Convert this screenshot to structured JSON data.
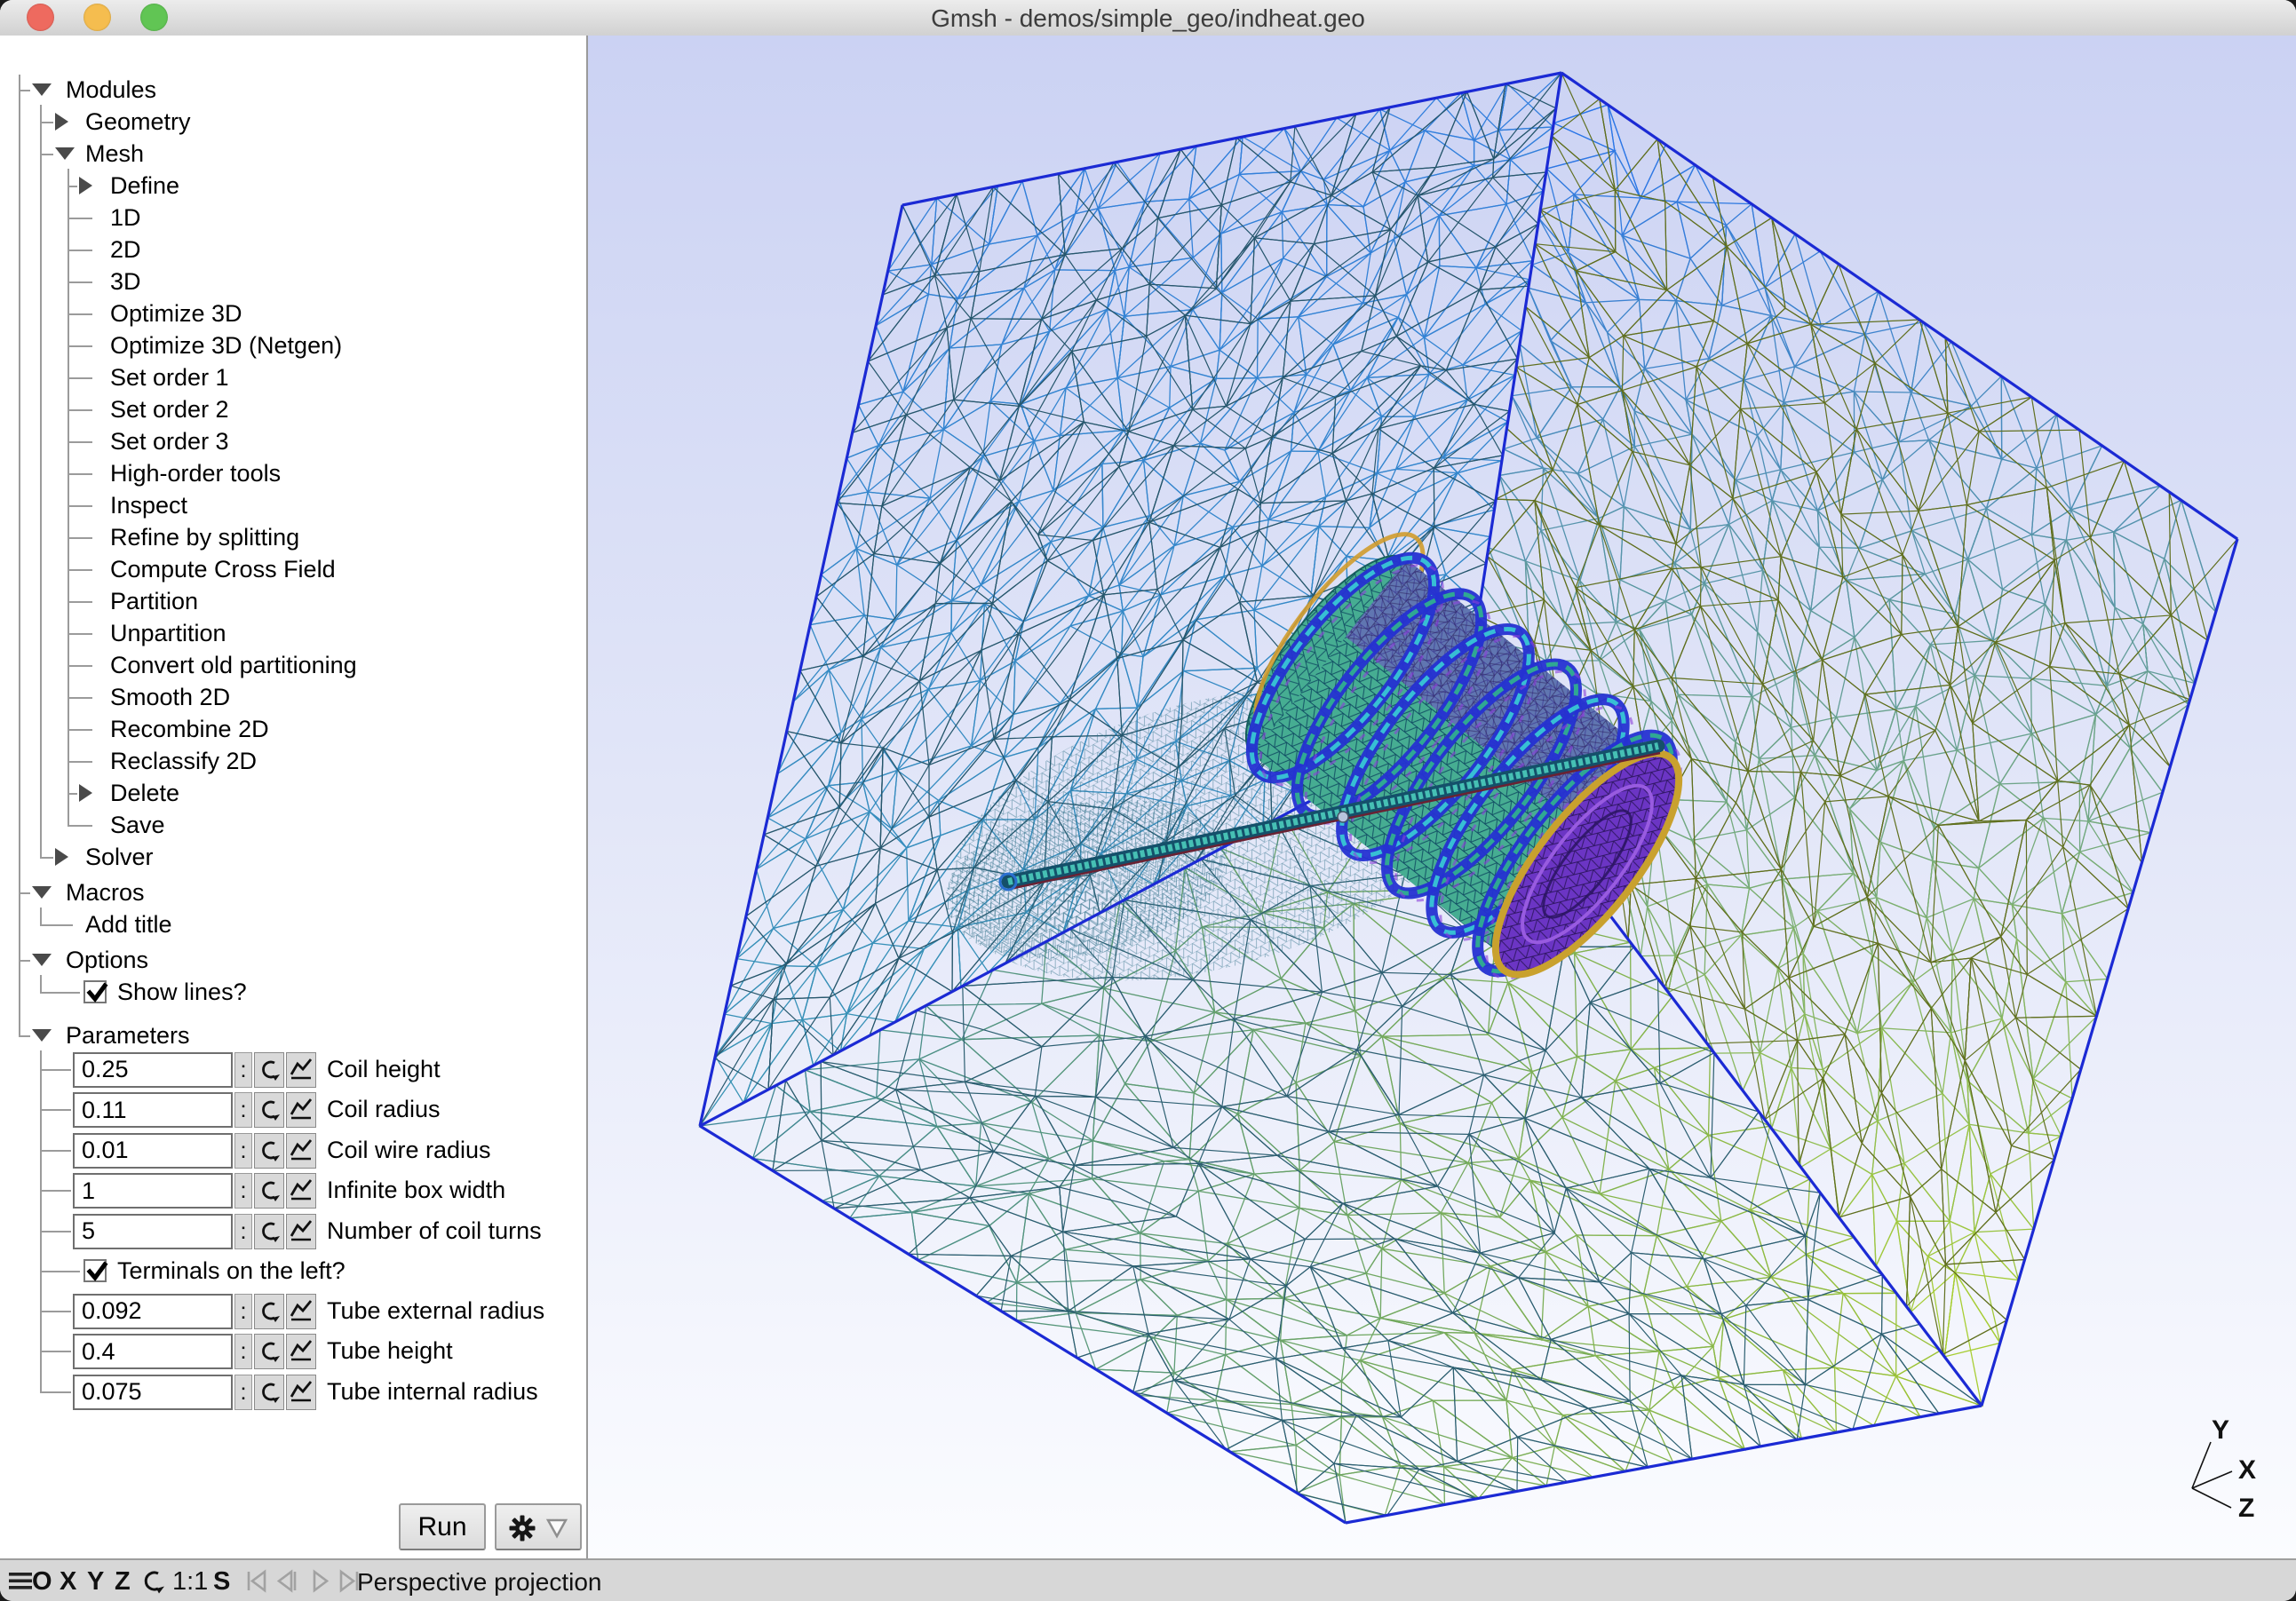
{
  "window": {
    "title": "Gmsh - demos/simple_geo/indheat.geo",
    "traffic_lights": [
      {
        "name": "close-button",
        "color": "#ee6a5f"
      },
      {
        "name": "minimize-button",
        "color": "#f5bd4f"
      },
      {
        "name": "zoom-button",
        "color": "#61c554"
      }
    ]
  },
  "tree": {
    "items": [
      {
        "type": "branch",
        "depth": 0,
        "state": "expanded",
        "label": "Modules"
      },
      {
        "type": "branch",
        "depth": 1,
        "state": "collapsed",
        "label": "Geometry"
      },
      {
        "type": "branch",
        "depth": 1,
        "state": "expanded",
        "label": "Mesh"
      },
      {
        "type": "branch",
        "depth": 2,
        "state": "collapsed",
        "label": "Define"
      },
      {
        "type": "leaf",
        "depth": 2,
        "label": "1D"
      },
      {
        "type": "leaf",
        "depth": 2,
        "label": "2D"
      },
      {
        "type": "leaf",
        "depth": 2,
        "label": "3D"
      },
      {
        "type": "leaf",
        "depth": 2,
        "label": "Optimize 3D"
      },
      {
        "type": "leaf",
        "depth": 2,
        "label": "Optimize 3D (Netgen)"
      },
      {
        "type": "leaf",
        "depth": 2,
        "label": "Set order 1"
      },
      {
        "type": "leaf",
        "depth": 2,
        "label": "Set order 2"
      },
      {
        "type": "leaf",
        "depth": 2,
        "label": "Set order 3"
      },
      {
        "type": "leaf",
        "depth": 2,
        "label": "High-order tools"
      },
      {
        "type": "leaf",
        "depth": 2,
        "label": "Inspect"
      },
      {
        "type": "leaf",
        "depth": 2,
        "label": "Refine by splitting"
      },
      {
        "type": "leaf",
        "depth": 2,
        "label": "Compute Cross Field"
      },
      {
        "type": "leaf",
        "depth": 2,
        "label": "Partition"
      },
      {
        "type": "leaf",
        "depth": 2,
        "label": "Unpartition"
      },
      {
        "type": "leaf",
        "depth": 2,
        "label": "Convert old partitioning"
      },
      {
        "type": "leaf",
        "depth": 2,
        "label": "Smooth 2D"
      },
      {
        "type": "leaf",
        "depth": 2,
        "label": "Recombine 2D"
      },
      {
        "type": "leaf",
        "depth": 2,
        "label": "Reclassify 2D"
      },
      {
        "type": "branch",
        "depth": 2,
        "state": "collapsed",
        "label": "Delete"
      },
      {
        "type": "leaf",
        "depth": 2,
        "label": "Save"
      },
      {
        "type": "branch",
        "depth": 1,
        "state": "collapsed",
        "label": "Solver"
      },
      {
        "type": "branch",
        "depth": 0,
        "state": "expanded",
        "label": "Macros"
      },
      {
        "type": "leaf",
        "depth": 1,
        "label": "Add title"
      },
      {
        "type": "branch",
        "depth": 0,
        "state": "expanded",
        "label": "Options"
      },
      {
        "type": "checkbox",
        "depth": 1,
        "checked": true,
        "label": "Show lines?"
      },
      {
        "type": "branch",
        "depth": 0,
        "state": "expanded",
        "label": "Parameters"
      },
      {
        "type": "param",
        "depth": 1,
        "value": "0.25",
        "label": "Coil height"
      },
      {
        "type": "param",
        "depth": 1,
        "value": "0.11",
        "label": "Coil radius"
      },
      {
        "type": "param",
        "depth": 1,
        "value": "0.01",
        "label": "Coil wire radius"
      },
      {
        "type": "param",
        "depth": 1,
        "value": "1",
        "label": "Infinite box width"
      },
      {
        "type": "param",
        "depth": 1,
        "value": "5",
        "label": "Number of coil turns"
      },
      {
        "type": "checkbox",
        "depth": 1,
        "checked": true,
        "label": "Terminals on the left?"
      },
      {
        "type": "param",
        "depth": 1,
        "value": "0.092",
        "label": "Tube external radius"
      },
      {
        "type": "param",
        "depth": 1,
        "value": "0.4",
        "label": "Tube height"
      },
      {
        "type": "param",
        "depth": 1,
        "value": "0.075",
        "label": "Tube internal radius"
      }
    ],
    "param_controls": {
      "colon": ":",
      "update_icon": "refresh-icon",
      "plot_icon": "chart-icon"
    }
  },
  "actions": {
    "run_label": "Run",
    "gear_icon": "gear-icon",
    "dropdown_icon": "triangle-down-icon"
  },
  "status_bar": {
    "menu_icon": "hamburger-icon",
    "axis_buttons": [
      "O",
      "X",
      "Y",
      "Z"
    ],
    "rotate_icon": "rotate-icon",
    "scale": "1:1",
    "snap": "S",
    "media_icons": [
      "skip-start-icon",
      "step-back-icon",
      "play-icon",
      "step-forward-icon"
    ],
    "projection": "Perspective projection"
  },
  "viewport": {
    "axis_triad": {
      "x": "X",
      "y": "Y",
      "z": "Z"
    },
    "colors": {
      "bg_top": "#cbd2f3",
      "bg_mid": "#e2e6f8",
      "bg_bottom": "#fbfcff",
      "cube_edge": "#1b2ad4",
      "left_bright_a": "#2b7ade",
      "left_bright_b": "#2f8fae",
      "left_dark": "#1d5066",
      "right_bright_a": "#1e6ef0",
      "right_bright_b": "#a4cc28",
      "right_dark": "#5a6a14",
      "bottom_bright_a": "#2f7e96",
      "bottom_bright_b": "#9cc428",
      "bottom_dark": "#23586a",
      "coil_body": "#46ad92",
      "coil_ring": "#2531d2",
      "coil_ring_hl": "#38c6d4",
      "coil_purple": "#7a3fd0",
      "coil_rim": "#c9a12e",
      "cap_purple": "#6b35c4",
      "rod_dark": "#14506a",
      "rod_teal": "#46c0b4",
      "rod_maroon": "#6a2233"
    }
  }
}
